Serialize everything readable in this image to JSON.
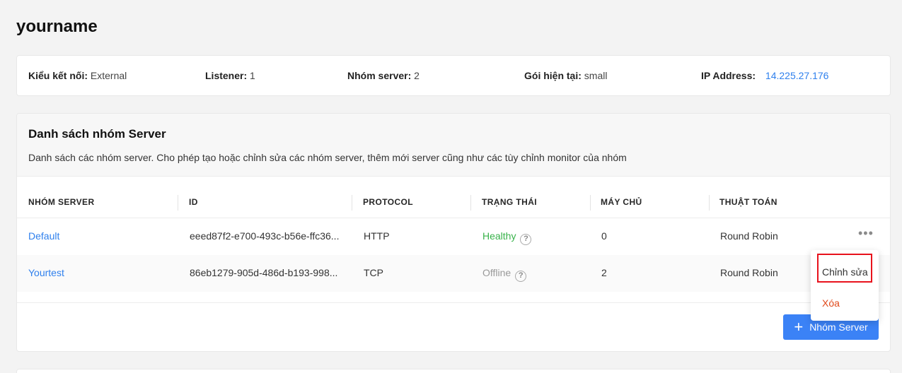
{
  "page": {
    "title": "yourname"
  },
  "info": {
    "connection_type": {
      "key": "Kiểu kết nối:",
      "value": "External"
    },
    "listener": {
      "key": "Listener:",
      "value": "1"
    },
    "server_group": {
      "key": "Nhóm server:",
      "value": "2"
    },
    "current_plan": {
      "key": "Gói hiện tại:",
      "value": "small"
    },
    "ip_address": {
      "key": "IP Address:",
      "value": "14.225.27.176"
    }
  },
  "section": {
    "title": "Danh sách nhóm Server",
    "description": "Danh sách các nhóm server. Cho phép tạo hoặc chỉnh sửa các nhóm server, thêm mới server cũng như các tùy chỉnh monitor của nhóm"
  },
  "table": {
    "columns": [
      "NHÓM SERVER",
      "ID",
      "PROTOCOL",
      "TRẠNG THÁI",
      "MÁY CHỦ",
      "THUẬT TOÁN"
    ],
    "rows": [
      {
        "name": "Default",
        "id": "eeed87f2-e700-493c-b56e-ffc36...",
        "protocol": "HTTP",
        "status": "Healthy",
        "servers": "0",
        "algorithm": "Round Robin"
      },
      {
        "name": "Yourtest",
        "id": "86eb1279-905d-486d-b193-998...",
        "protocol": "TCP",
        "status": "Offline",
        "servers": "2",
        "algorithm": "Round Robin"
      }
    ],
    "more_label": "•••",
    "help_icon": "?"
  },
  "dropdown": {
    "edit": "Chỉnh sửa",
    "delete": "Xóa"
  },
  "actions": {
    "add_label": "Nhóm Server",
    "add_icon": "+"
  },
  "colors": {
    "accent": "#3b82f6",
    "link": "#2f80ed",
    "healthy": "#38b24a",
    "danger": "#e0491a",
    "highlight": "#e8121c"
  }
}
